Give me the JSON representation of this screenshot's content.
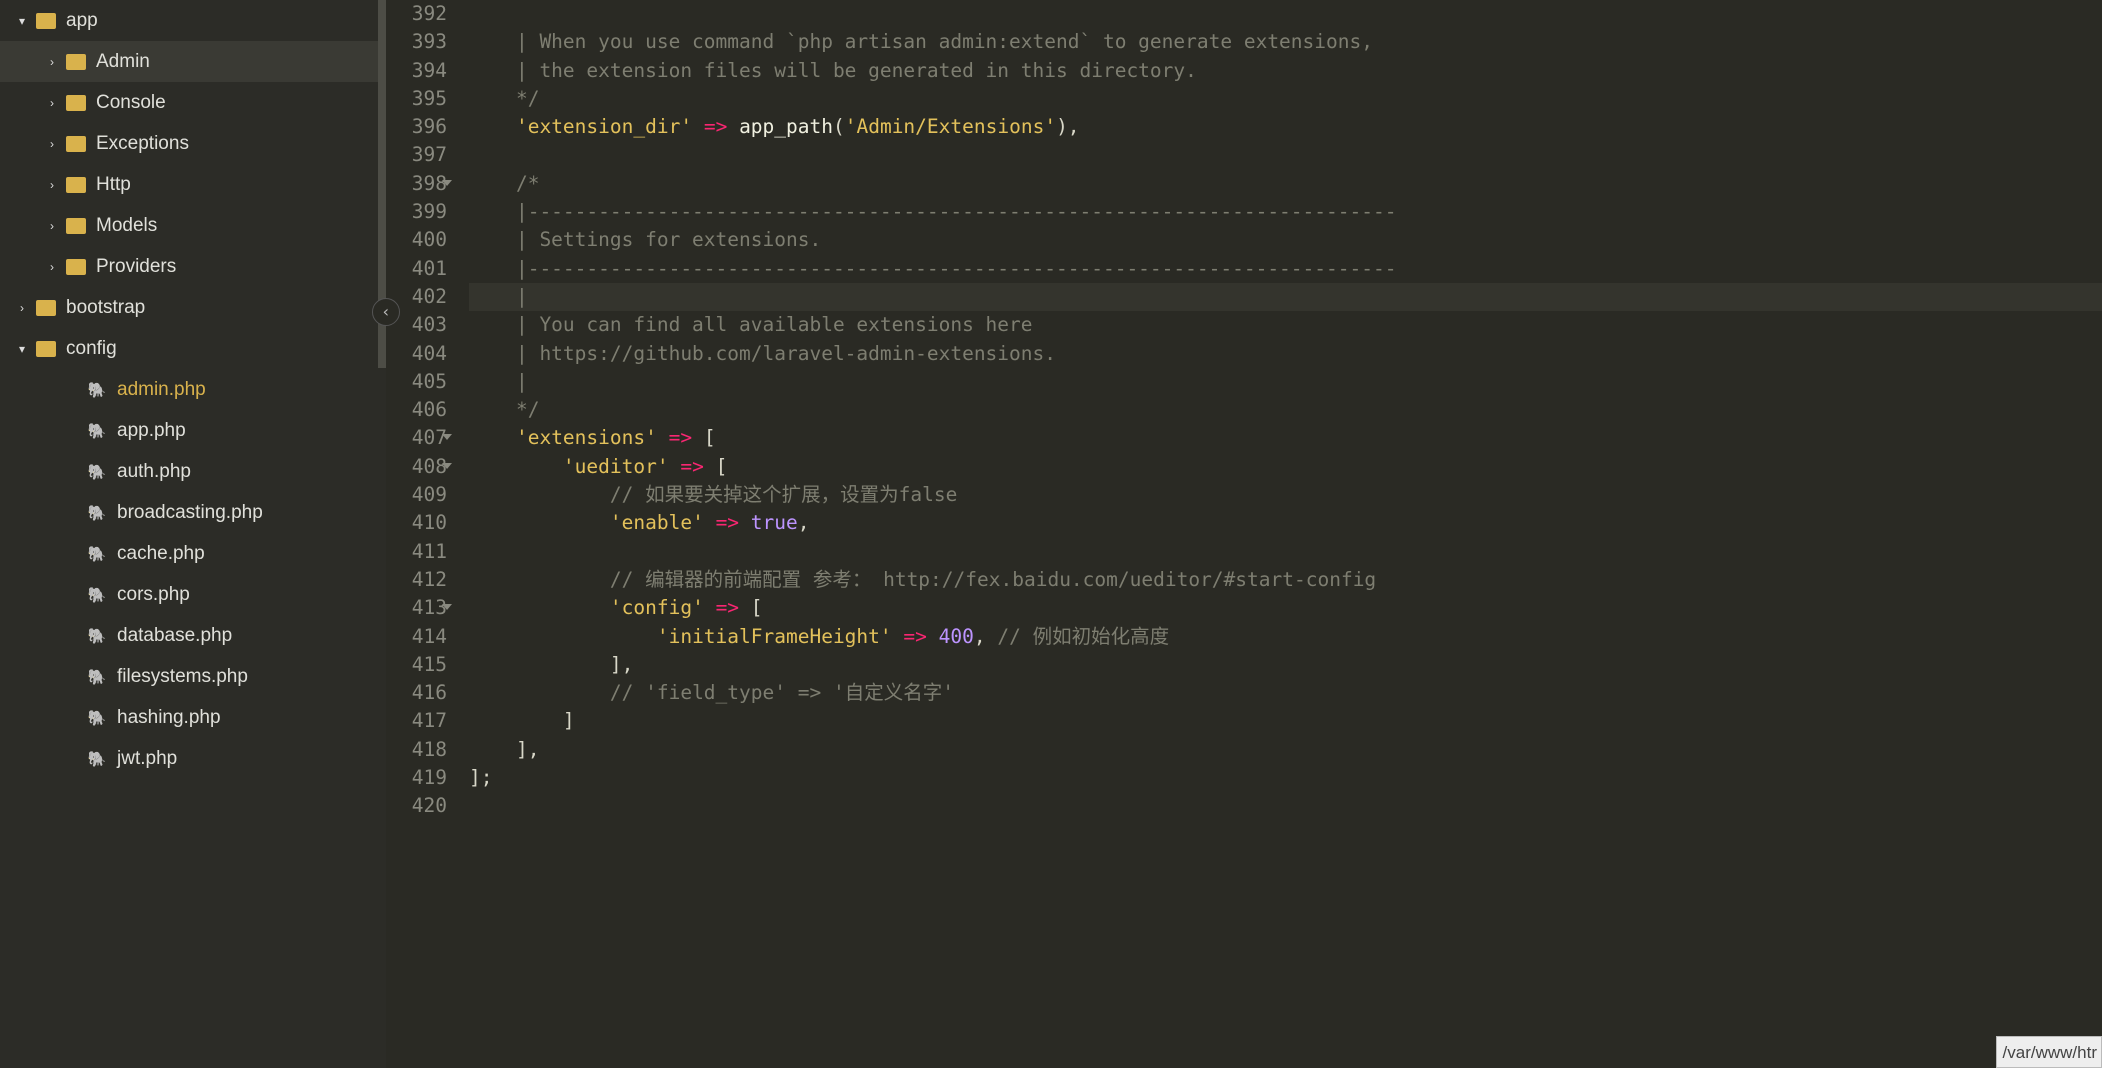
{
  "sidebar": {
    "items": [
      {
        "caret": "down",
        "indent": 15,
        "icon": "folder",
        "label": "app",
        "active": false
      },
      {
        "caret": "right",
        "indent": 45,
        "icon": "folder",
        "label": "Admin",
        "active": true
      },
      {
        "caret": "right",
        "indent": 45,
        "icon": "folder",
        "label": "Console",
        "active": false
      },
      {
        "caret": "right",
        "indent": 45,
        "icon": "folder",
        "label": "Exceptions",
        "active": false
      },
      {
        "caret": "right",
        "indent": 45,
        "icon": "folder",
        "label": "Http",
        "active": false
      },
      {
        "caret": "right",
        "indent": 45,
        "icon": "folder",
        "label": "Models",
        "active": false
      },
      {
        "caret": "right",
        "indent": 45,
        "icon": "folder",
        "label": "Providers",
        "active": false
      },
      {
        "caret": "right",
        "indent": 15,
        "icon": "folder",
        "label": "bootstrap",
        "active": false
      },
      {
        "caret": "down",
        "indent": 15,
        "icon": "folder",
        "label": "config",
        "active": false
      },
      {
        "caret": "",
        "indent": 66,
        "icon": "php",
        "label": "admin.php",
        "active": false,
        "selected": true
      },
      {
        "caret": "",
        "indent": 66,
        "icon": "php",
        "label": "app.php",
        "active": false
      },
      {
        "caret": "",
        "indent": 66,
        "icon": "php",
        "label": "auth.php",
        "active": false
      },
      {
        "caret": "",
        "indent": 66,
        "icon": "php",
        "label": "broadcasting.php",
        "active": false
      },
      {
        "caret": "",
        "indent": 66,
        "icon": "php",
        "label": "cache.php",
        "active": false
      },
      {
        "caret": "",
        "indent": 66,
        "icon": "php",
        "label": "cors.php",
        "active": false
      },
      {
        "caret": "",
        "indent": 66,
        "icon": "php",
        "label": "database.php",
        "active": false
      },
      {
        "caret": "",
        "indent": 66,
        "icon": "php",
        "label": "filesystems.php",
        "active": false
      },
      {
        "caret": "",
        "indent": 66,
        "icon": "php",
        "label": "hashing.php",
        "active": false
      },
      {
        "caret": "",
        "indent": 66,
        "icon": "php",
        "label": "jwt.php",
        "active": false
      }
    ]
  },
  "editor": {
    "lines": [
      {
        "n": "392",
        "fold": false,
        "cursor": false,
        "tokens": []
      },
      {
        "n": "393",
        "fold": false,
        "cursor": false,
        "tokens": [
          {
            "c": "cmt",
            "t": "    | When you use command `php artisan admin:extend` to generate extensions,"
          }
        ]
      },
      {
        "n": "394",
        "fold": false,
        "cursor": false,
        "tokens": [
          {
            "c": "cmt",
            "t": "    | the extension files will be generated in this directory."
          }
        ]
      },
      {
        "n": "395",
        "fold": false,
        "cursor": false,
        "tokens": [
          {
            "c": "cmt",
            "t": "    */"
          }
        ]
      },
      {
        "n": "396",
        "fold": false,
        "cursor": false,
        "tokens": [
          {
            "c": "punct",
            "t": "    "
          },
          {
            "c": "str",
            "t": "'extension_dir'"
          },
          {
            "c": "punct",
            "t": " "
          },
          {
            "c": "kw",
            "t": "=>"
          },
          {
            "c": "punct",
            "t": " "
          },
          {
            "c": "id",
            "t": "app_path"
          },
          {
            "c": "punct",
            "t": "("
          },
          {
            "c": "str",
            "t": "'Admin/Extensions'"
          },
          {
            "c": "punct",
            "t": "),"
          }
        ]
      },
      {
        "n": "397",
        "fold": false,
        "cursor": false,
        "tokens": []
      },
      {
        "n": "398",
        "fold": true,
        "cursor": false,
        "tokens": [
          {
            "c": "cmt",
            "t": "    /*"
          }
        ]
      },
      {
        "n": "399",
        "fold": false,
        "cursor": false,
        "tokens": [
          {
            "c": "cmt",
            "t": "    |--------------------------------------------------------------------------"
          }
        ]
      },
      {
        "n": "400",
        "fold": false,
        "cursor": false,
        "tokens": [
          {
            "c": "cmt",
            "t": "    | Settings for extensions."
          }
        ]
      },
      {
        "n": "401",
        "fold": false,
        "cursor": false,
        "tokens": [
          {
            "c": "cmt",
            "t": "    |--------------------------------------------------------------------------"
          }
        ]
      },
      {
        "n": "402",
        "fold": false,
        "cursor": true,
        "tokens": [
          {
            "c": "cmt",
            "t": "    |"
          }
        ]
      },
      {
        "n": "403",
        "fold": false,
        "cursor": false,
        "tokens": [
          {
            "c": "cmt",
            "t": "    | You can find all available extensions here"
          }
        ]
      },
      {
        "n": "404",
        "fold": false,
        "cursor": false,
        "tokens": [
          {
            "c": "cmt",
            "t": "    | https://github.com/laravel-admin-extensions."
          }
        ]
      },
      {
        "n": "405",
        "fold": false,
        "cursor": false,
        "tokens": [
          {
            "c": "cmt",
            "t": "    |"
          }
        ]
      },
      {
        "n": "406",
        "fold": false,
        "cursor": false,
        "tokens": [
          {
            "c": "cmt",
            "t": "    */"
          }
        ]
      },
      {
        "n": "407",
        "fold": true,
        "cursor": false,
        "tokens": [
          {
            "c": "punct",
            "t": "    "
          },
          {
            "c": "str",
            "t": "'extensions'"
          },
          {
            "c": "punct",
            "t": " "
          },
          {
            "c": "kw",
            "t": "=>"
          },
          {
            "c": "punct",
            "t": " ["
          }
        ]
      },
      {
        "n": "408",
        "fold": true,
        "cursor": false,
        "tokens": [
          {
            "c": "punct",
            "t": "        "
          },
          {
            "c": "str",
            "t": "'ueditor'"
          },
          {
            "c": "punct",
            "t": " "
          },
          {
            "c": "kw",
            "t": "=>"
          },
          {
            "c": "punct",
            "t": " ["
          }
        ]
      },
      {
        "n": "409",
        "fold": false,
        "cursor": false,
        "tokens": [
          {
            "c": "punct",
            "t": "            "
          },
          {
            "c": "cmt",
            "t": "// 如果要关掉这个扩展，设置为false"
          }
        ]
      },
      {
        "n": "410",
        "fold": false,
        "cursor": false,
        "tokens": [
          {
            "c": "punct",
            "t": "            "
          },
          {
            "c": "str",
            "t": "'enable'"
          },
          {
            "c": "punct",
            "t": " "
          },
          {
            "c": "kw",
            "t": "=>"
          },
          {
            "c": "punct",
            "t": " "
          },
          {
            "c": "bool",
            "t": "true"
          },
          {
            "c": "punct",
            "t": ","
          }
        ]
      },
      {
        "n": "411",
        "fold": false,
        "cursor": false,
        "tokens": []
      },
      {
        "n": "412",
        "fold": false,
        "cursor": false,
        "tokens": [
          {
            "c": "punct",
            "t": "            "
          },
          {
            "c": "cmt",
            "t": "// 编辑器的前端配置 参考： http://fex.baidu.com/ueditor/#start-config"
          }
        ]
      },
      {
        "n": "413",
        "fold": true,
        "cursor": false,
        "tokens": [
          {
            "c": "punct",
            "t": "            "
          },
          {
            "c": "str",
            "t": "'config'"
          },
          {
            "c": "punct",
            "t": " "
          },
          {
            "c": "kw",
            "t": "=>"
          },
          {
            "c": "punct",
            "t": " ["
          }
        ]
      },
      {
        "n": "414",
        "fold": false,
        "cursor": false,
        "tokens": [
          {
            "c": "punct",
            "t": "                "
          },
          {
            "c": "str",
            "t": "'initialFrameHeight'"
          },
          {
            "c": "punct",
            "t": " "
          },
          {
            "c": "kw",
            "t": "=>"
          },
          {
            "c": "punct",
            "t": " "
          },
          {
            "c": "num",
            "t": "400"
          },
          {
            "c": "punct",
            "t": ", "
          },
          {
            "c": "cmt",
            "t": "// 例如初始化高度"
          }
        ]
      },
      {
        "n": "415",
        "fold": false,
        "cursor": false,
        "tokens": [
          {
            "c": "punct",
            "t": "            ],"
          }
        ]
      },
      {
        "n": "416",
        "fold": false,
        "cursor": false,
        "tokens": [
          {
            "c": "punct",
            "t": "            "
          },
          {
            "c": "cmt",
            "t": "// 'field_type' => '自定义名字'"
          }
        ]
      },
      {
        "n": "417",
        "fold": false,
        "cursor": false,
        "tokens": [
          {
            "c": "punct",
            "t": "        ]"
          }
        ]
      },
      {
        "n": "418",
        "fold": false,
        "cursor": false,
        "tokens": [
          {
            "c": "punct",
            "t": "    ],"
          }
        ]
      },
      {
        "n": "419",
        "fold": false,
        "cursor": false,
        "tokens": [
          {
            "c": "punct",
            "t": "];"
          }
        ]
      },
      {
        "n": "420",
        "fold": false,
        "cursor": false,
        "tokens": []
      }
    ]
  },
  "statusbar": {
    "path": "/var/www/htr"
  },
  "glyph": {
    "caret_down": "▾",
    "caret_right": "›",
    "collapse": "‹"
  }
}
